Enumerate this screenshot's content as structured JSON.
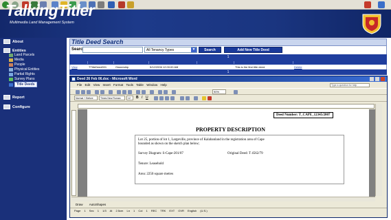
{
  "header": {
    "title": "TalkingTitler",
    "subtitle": "Multimedia Land Management System"
  },
  "sidebar": {
    "groups": [
      {
        "label": "About"
      },
      {
        "label": "Entities"
      },
      {
        "label": "Report"
      },
      {
        "label": "Configure"
      }
    ],
    "items": [
      {
        "label": "Land Parcels"
      },
      {
        "label": "Media"
      },
      {
        "label": "People"
      },
      {
        "label": "Physical Entities"
      },
      {
        "label": "Partial Rights"
      },
      {
        "label": "Survey Plans"
      },
      {
        "label": "Title Deeds"
      }
    ]
  },
  "main": {
    "title": "Title Deed Search",
    "search_label": "Search",
    "search_value": "",
    "tenancy_selected": "All Tenancy Types",
    "search_button": "Search",
    "add_button": "Add New Title Deed",
    "pager_top": "1",
    "pager_bottom": "1",
    "row": {
      "action": "View",
      "deed": "TTitleDeed001",
      "type": "Ownership",
      "date": "5/12/2006 12:00:00 AM",
      "description": "This is the first title deed.",
      "link": "Delete"
    }
  },
  "word": {
    "title": "Deed 26 Feb 06.doc - Microsoft Word",
    "menu": [
      "File",
      "Edit",
      "View",
      "Insert",
      "Format",
      "Tools",
      "Table",
      "Window",
      "Help"
    ],
    "style_box": "Normal + Before",
    "font_box": "Times New Roman",
    "size_box": "12",
    "zoom": "90%",
    "help_placeholder": "Type a question for help",
    "deed_number": "Deed Number: T_CAPE_12345/2007",
    "heading": "PROPERTY DESCRIPTION",
    "paragraph1_line1": "Lot 25, portion of lot 1, Largeville, province of Kalabanland in the registration area of Cape",
    "paragraph1_line2": "bounded as  shown on the sketch plan below;",
    "survey_diagram": "Survey Diagram:  S-Cape-201/07",
    "original_deed": "Original Deed: T 4562/79",
    "tenure": "Tenure: Leasehold",
    "area": "Area:  2250 square metres",
    "draw_label": "Draw",
    "autoshapes_label": "AutoShapes",
    "status": "Page 1    Sec 1    1/3    At 2.5cm    Ln 1    Col 1    REC  TRK  EXT  OVR    English (U.S.)"
  },
  "colors": {
    "header_bg": "#1d3a8a",
    "sidebar_bg": "#1a307a",
    "grid_header": "#1f3e9e",
    "button_bg": "#1a3a9a"
  }
}
